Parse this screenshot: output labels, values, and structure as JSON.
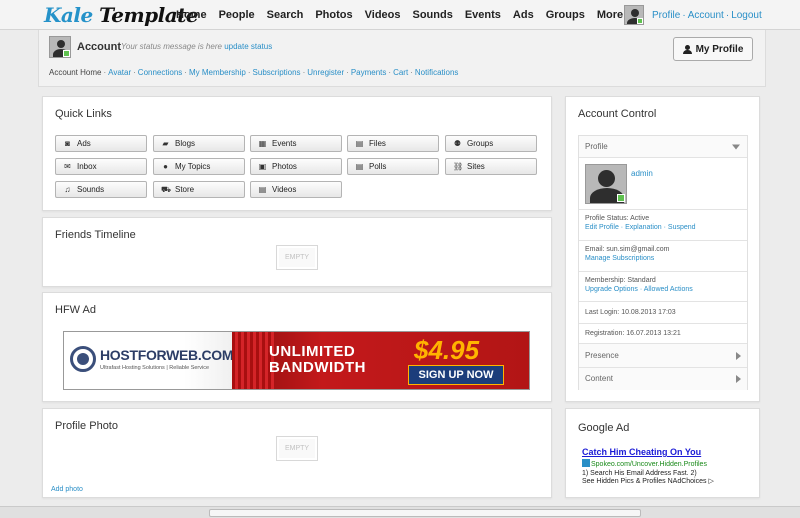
{
  "brand": {
    "logo_k": "Kale",
    "logo_t": "Template"
  },
  "nav": [
    "Home",
    "People",
    "Search",
    "Photos",
    "Videos",
    "Sounds",
    "Events",
    "Ads",
    "Groups",
    "More"
  ],
  "user_links": [
    "Profile",
    "Account",
    "Logout"
  ],
  "account": {
    "title": "Account",
    "status_prompt": "Your status message is here",
    "update_status": "update status",
    "my_profile_button": "My Profile",
    "subnav_current": "Account Home",
    "subnav": [
      "Avatar",
      "Connections",
      "My Membership",
      "Subscriptions",
      "Unregister",
      "Payments",
      "Cart",
      "Notifications"
    ]
  },
  "quick_links": {
    "title": "Quick Links",
    "items": [
      {
        "label": "Ads",
        "icon": "camera-icon",
        "glyph": "◙"
      },
      {
        "label": "Blogs",
        "icon": "book-icon",
        "glyph": "▰"
      },
      {
        "label": "Events",
        "icon": "calendar-icon",
        "glyph": "▦"
      },
      {
        "label": "Files",
        "icon": "file-icon",
        "glyph": "▤"
      },
      {
        "label": "Groups",
        "icon": "users-icon",
        "glyph": "⚉"
      },
      {
        "label": "Inbox",
        "icon": "envelope-icon",
        "glyph": "✉"
      },
      {
        "label": "My Topics",
        "icon": "comments-icon",
        "glyph": "●"
      },
      {
        "label": "Photos",
        "icon": "picture-icon",
        "glyph": "▣"
      },
      {
        "label": "Polls",
        "icon": "list-icon",
        "glyph": "▤"
      },
      {
        "label": "Sites",
        "icon": "link-icon",
        "glyph": "⛓"
      },
      {
        "label": "Sounds",
        "icon": "music-icon",
        "glyph": "♫"
      },
      {
        "label": "Store",
        "icon": "cart-icon",
        "glyph": "⛟"
      },
      {
        "label": "Videos",
        "icon": "film-icon",
        "glyph": "▤"
      }
    ]
  },
  "friends_timeline": {
    "title": "Friends Timeline",
    "empty": "EMPTY"
  },
  "hfw_ad": {
    "title": "HFW Ad",
    "brand": "HOSTFORWEB.COM",
    "tagline": "Ultrafast Hosting Solutions | Reliable Service",
    "headline1": "UNLIMITED",
    "headline2": "BANDWIDTH",
    "price": "$4.95",
    "cta": "SIGN UP NOW"
  },
  "profile_photo": {
    "title": "Profile Photo",
    "empty": "EMPTY",
    "add_photo": "Add photo"
  },
  "account_control": {
    "title": "Account Control",
    "profile_section": "Profile",
    "username": "admin",
    "profile_status_label": "Profile Status: Active",
    "profile_links": [
      "Edit Profile",
      "Explanation",
      "Suspend"
    ],
    "email_label": "Email: sun.sim@gmail.com",
    "manage_subscriptions": "Manage Subscriptions",
    "membership_label": "Membership: Standard",
    "membership_links": [
      "Upgrade Options",
      "Allowed Actions"
    ],
    "last_login": "Last Login: 10.08.2013 17:03",
    "registration": "Registration: 16.07.2013 13:21",
    "presence": "Presence",
    "content": "Content"
  },
  "google_ad": {
    "title": "Google Ad",
    "headline": "Catch Him Cheating On You",
    "url": "Spokeo.com/Uncover.Hidden.Profiles",
    "line1": "1) Search His Email Address Fast. 2)",
    "line2": "See Hidden Pics & Profiles N",
    "adchoices": "AdChoices"
  },
  "colors": {
    "link": "#2a8fc7",
    "online": "#5fc14f",
    "banner_red": "#c3191b",
    "price_yellow": "#ffb400"
  }
}
